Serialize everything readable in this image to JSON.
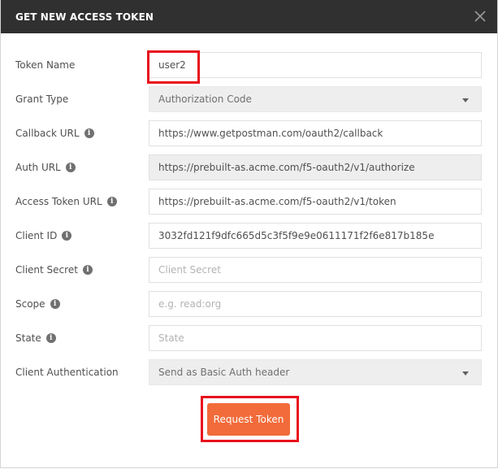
{
  "dialog": {
    "title": "GET NEW ACCESS TOKEN",
    "close_icon": "close-icon"
  },
  "form": {
    "token_name": {
      "label": "Token Name",
      "value": "user2"
    },
    "grant_type": {
      "label": "Grant Type",
      "selected": "Authorization Code"
    },
    "callback_url": {
      "label": "Callback URL",
      "value": "https://www.getpostman.com/oauth2/callback"
    },
    "auth_url": {
      "label": "Auth URL",
      "value": "https://prebuilt-as.acme.com/f5-oauth2/v1/authorize"
    },
    "access_token_url": {
      "label": "Access Token URL",
      "value": "https://prebuilt-as.acme.com/f5-oauth2/v1/token"
    },
    "client_id": {
      "label": "Client ID",
      "value": "3032fd121f9dfc665d5c3f5f9e9e0611171f2f6e817b185e"
    },
    "client_secret": {
      "label": "Client Secret",
      "placeholder": "Client Secret"
    },
    "scope": {
      "label": "Scope",
      "placeholder": "e.g. read:org"
    },
    "state": {
      "label": "State",
      "placeholder": "State"
    },
    "client_authentication": {
      "label": "Client Authentication",
      "selected": "Send as Basic Auth header"
    }
  },
  "actions": {
    "request_token_label": "Request Token"
  },
  "colors": {
    "header_bg": "#303030",
    "button_bg": "#f26b3a",
    "highlight": "#e8101c"
  }
}
